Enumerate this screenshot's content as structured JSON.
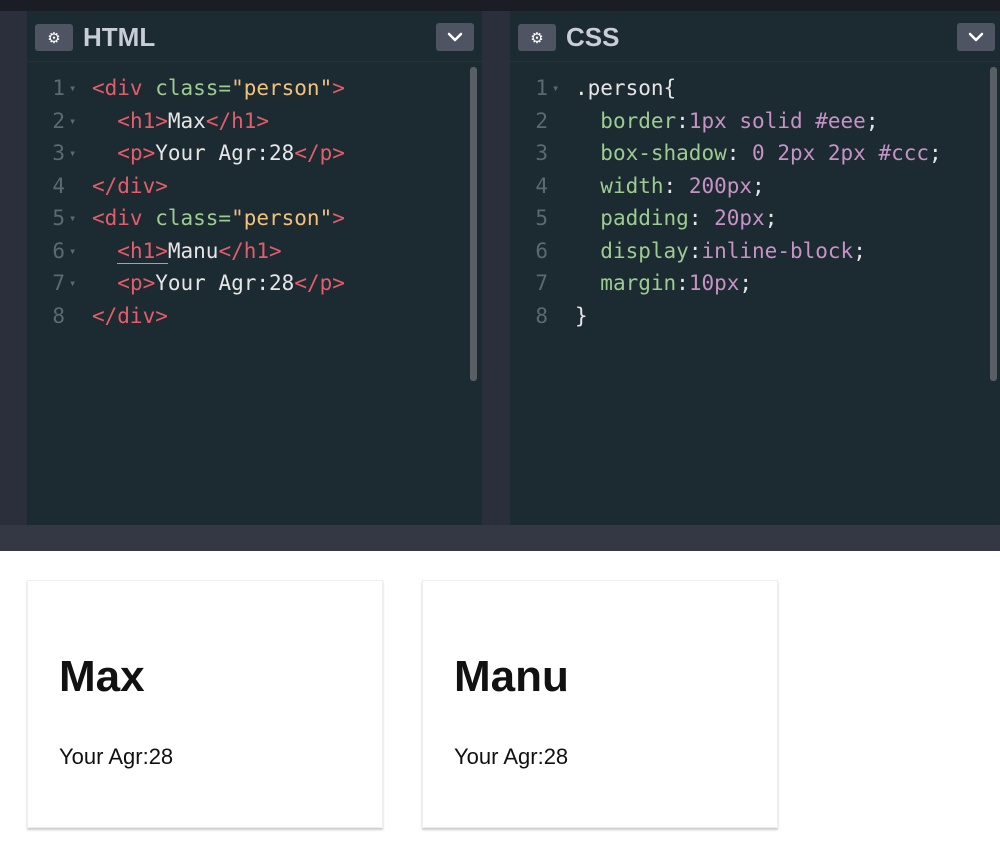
{
  "html_pane": {
    "title": "HTML",
    "lines": [
      {
        "n": "1",
        "fold": true,
        "tokens": [
          {
            "t": "tag",
            "v": "<div "
          },
          {
            "t": "attr",
            "v": "class="
          },
          {
            "t": "str",
            "v": "\"person\""
          },
          {
            "t": "tag",
            "v": ">"
          }
        ]
      },
      {
        "n": "2",
        "fold": true,
        "tokens": [
          {
            "t": "plain",
            "v": "  "
          },
          {
            "t": "tag",
            "v": "<h1>"
          },
          {
            "t": "plain",
            "v": "Max"
          },
          {
            "t": "tag",
            "v": "</h1>"
          }
        ]
      },
      {
        "n": "3",
        "fold": true,
        "tokens": [
          {
            "t": "plain",
            "v": "  "
          },
          {
            "t": "tag",
            "v": "<p>"
          },
          {
            "t": "plain",
            "v": "Your Agr:28"
          },
          {
            "t": "tag",
            "v": "</p>"
          }
        ]
      },
      {
        "n": "4",
        "fold": false,
        "tokens": [
          {
            "t": "tag",
            "v": "</div>"
          }
        ]
      },
      {
        "n": "5",
        "fold": true,
        "tokens": [
          {
            "t": "tag",
            "v": "<div "
          },
          {
            "t": "attr",
            "v": "class="
          },
          {
            "t": "str",
            "v": "\"person\""
          },
          {
            "t": "tag",
            "v": ">"
          }
        ]
      },
      {
        "n": "6",
        "fold": true,
        "tokens": [
          {
            "t": "plain",
            "v": "  "
          },
          {
            "t": "tag",
            "v": "<h1>",
            "u": true
          },
          {
            "t": "plain",
            "v": "Manu"
          },
          {
            "t": "tag",
            "v": "</h1>"
          }
        ]
      },
      {
        "n": "7",
        "fold": true,
        "tokens": [
          {
            "t": "plain",
            "v": "  "
          },
          {
            "t": "tag",
            "v": "<p>"
          },
          {
            "t": "plain",
            "v": "Your Agr:28"
          },
          {
            "t": "tag",
            "v": "</p>"
          }
        ]
      },
      {
        "n": "8",
        "fold": false,
        "tokens": [
          {
            "t": "tag",
            "v": "</div>"
          }
        ]
      }
    ]
  },
  "css_pane": {
    "title": "CSS",
    "lines": [
      {
        "n": "1",
        "fold": true,
        "tokens": [
          {
            "t": "sel",
            "v": ".person{"
          }
        ]
      },
      {
        "n": "2",
        "fold": false,
        "tokens": [
          {
            "t": "plain",
            "v": "  "
          },
          {
            "t": "prop",
            "v": "border"
          },
          {
            "t": "plain",
            "v": ":"
          },
          {
            "t": "val",
            "v": "1px solid #eee"
          },
          {
            "t": "plain",
            "v": ";"
          }
        ]
      },
      {
        "n": "3",
        "fold": false,
        "tokens": [
          {
            "t": "plain",
            "v": "  "
          },
          {
            "t": "prop",
            "v": "box-shadow"
          },
          {
            "t": "plain",
            "v": ": "
          },
          {
            "t": "val",
            "v": "0 2px 2px #ccc"
          },
          {
            "t": "plain",
            "v": ";"
          }
        ]
      },
      {
        "n": "4",
        "fold": false,
        "tokens": [
          {
            "t": "plain",
            "v": "  "
          },
          {
            "t": "prop",
            "v": "width"
          },
          {
            "t": "plain",
            "v": ": "
          },
          {
            "t": "val",
            "v": "200px"
          },
          {
            "t": "plain",
            "v": ";"
          }
        ]
      },
      {
        "n": "5",
        "fold": false,
        "tokens": [
          {
            "t": "plain",
            "v": "  "
          },
          {
            "t": "prop",
            "v": "padding"
          },
          {
            "t": "plain",
            "v": ": "
          },
          {
            "t": "val",
            "v": "20px"
          },
          {
            "t": "plain",
            "v": ";"
          }
        ]
      },
      {
        "n": "6",
        "fold": false,
        "tokens": [
          {
            "t": "plain",
            "v": "  "
          },
          {
            "t": "prop",
            "v": "display"
          },
          {
            "t": "plain",
            "v": ":"
          },
          {
            "t": "val",
            "v": "inline-block"
          },
          {
            "t": "plain",
            "v": ";"
          }
        ]
      },
      {
        "n": "7",
        "fold": false,
        "tokens": [
          {
            "t": "plain",
            "v": "  "
          },
          {
            "t": "prop",
            "v": "margin"
          },
          {
            "t": "plain",
            "v": ":"
          },
          {
            "t": "val",
            "v": "10px"
          },
          {
            "t": "plain",
            "v": ";"
          }
        ]
      },
      {
        "n": "8",
        "fold": false,
        "tokens": [
          {
            "t": "sel",
            "v": "}"
          }
        ]
      }
    ]
  },
  "preview": {
    "cards": [
      {
        "heading": "Max",
        "text": "Your Agr:28"
      },
      {
        "heading": "Manu",
        "text": "Your Agr:28"
      }
    ]
  },
  "icons": {
    "settings": "gear-icon",
    "collapse": "chevron-down-icon",
    "fold": "fold-arrow-icon"
  },
  "colors": {
    "editor_bg": "#1c2a31",
    "tag": "#e35d6a",
    "attr": "#9ccc8f",
    "string": "#f2c27b",
    "value": "#c792c6"
  }
}
